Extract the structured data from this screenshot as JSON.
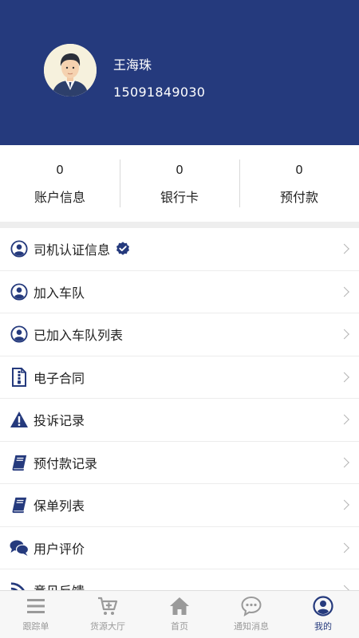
{
  "profile": {
    "name": "王海珠",
    "phone": "15091849030"
  },
  "stats": [
    {
      "value": "0",
      "label": "账户信息"
    },
    {
      "value": "0",
      "label": "银行卡"
    },
    {
      "value": "0",
      "label": "预付款"
    }
  ],
  "menu": [
    {
      "label": "司机认证信息",
      "icon": "person-circle-icon",
      "verified": true
    },
    {
      "label": "加入车队",
      "icon": "person-circle-icon"
    },
    {
      "label": "已加入车队列表",
      "icon": "person-circle-icon"
    },
    {
      "label": "电子合同",
      "icon": "contract-icon"
    },
    {
      "label": "投诉记录",
      "icon": "warning-icon"
    },
    {
      "label": "预付款记录",
      "icon": "book-icon"
    },
    {
      "label": "保单列表",
      "icon": "book-icon"
    },
    {
      "label": "用户评价",
      "icon": "chat-bubbles-icon"
    },
    {
      "label": "意见反馈",
      "icon": "rss-icon"
    }
  ],
  "tabs": [
    {
      "label": "跟踪单",
      "icon": "list-icon"
    },
    {
      "label": "货源大厅",
      "icon": "cart-plus-icon"
    },
    {
      "label": "首页",
      "icon": "home-icon"
    },
    {
      "label": "通知消息",
      "icon": "message-icon"
    },
    {
      "label": "我的",
      "icon": "user-icon",
      "active": true
    }
  ],
  "colors": {
    "primary": "#253a7d",
    "tab_inactive": "#9a9a9a",
    "divider": "#ececec"
  }
}
